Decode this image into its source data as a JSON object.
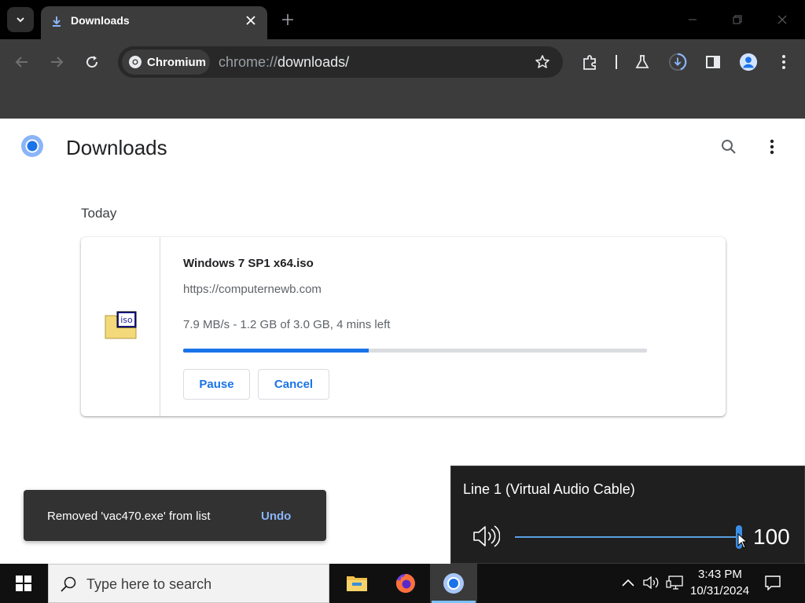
{
  "browser": {
    "tab": {
      "title": "Downloads"
    },
    "omnibox": {
      "chip_label": "Chromium",
      "url_scheme": "chrome://",
      "url_path": "downloads/"
    }
  },
  "page": {
    "title": "Downloads",
    "section": "Today",
    "download": {
      "icon_label": "iso",
      "filename": "Windows 7 SP1 x64.iso",
      "url": "https://computernewb.com",
      "status": "7.9 MB/s - 1.2 GB of 3.0 GB, 4 mins left",
      "progress": 0.4,
      "pause_label": "Pause",
      "cancel_label": "Cancel"
    }
  },
  "snackbar": {
    "message": "Removed 'vac470.exe' from list",
    "action": "Undo"
  },
  "volume_flyout": {
    "device": "Line 1 (Virtual Audio Cable)",
    "level": 100
  },
  "taskbar": {
    "search_placeholder": "Type here to search",
    "time": "3:43 PM",
    "date": "10/31/2024"
  },
  "colors": {
    "accent": "#1a73e8",
    "link": "#8ab4f8",
    "volume_accent": "#3a8ee6"
  }
}
